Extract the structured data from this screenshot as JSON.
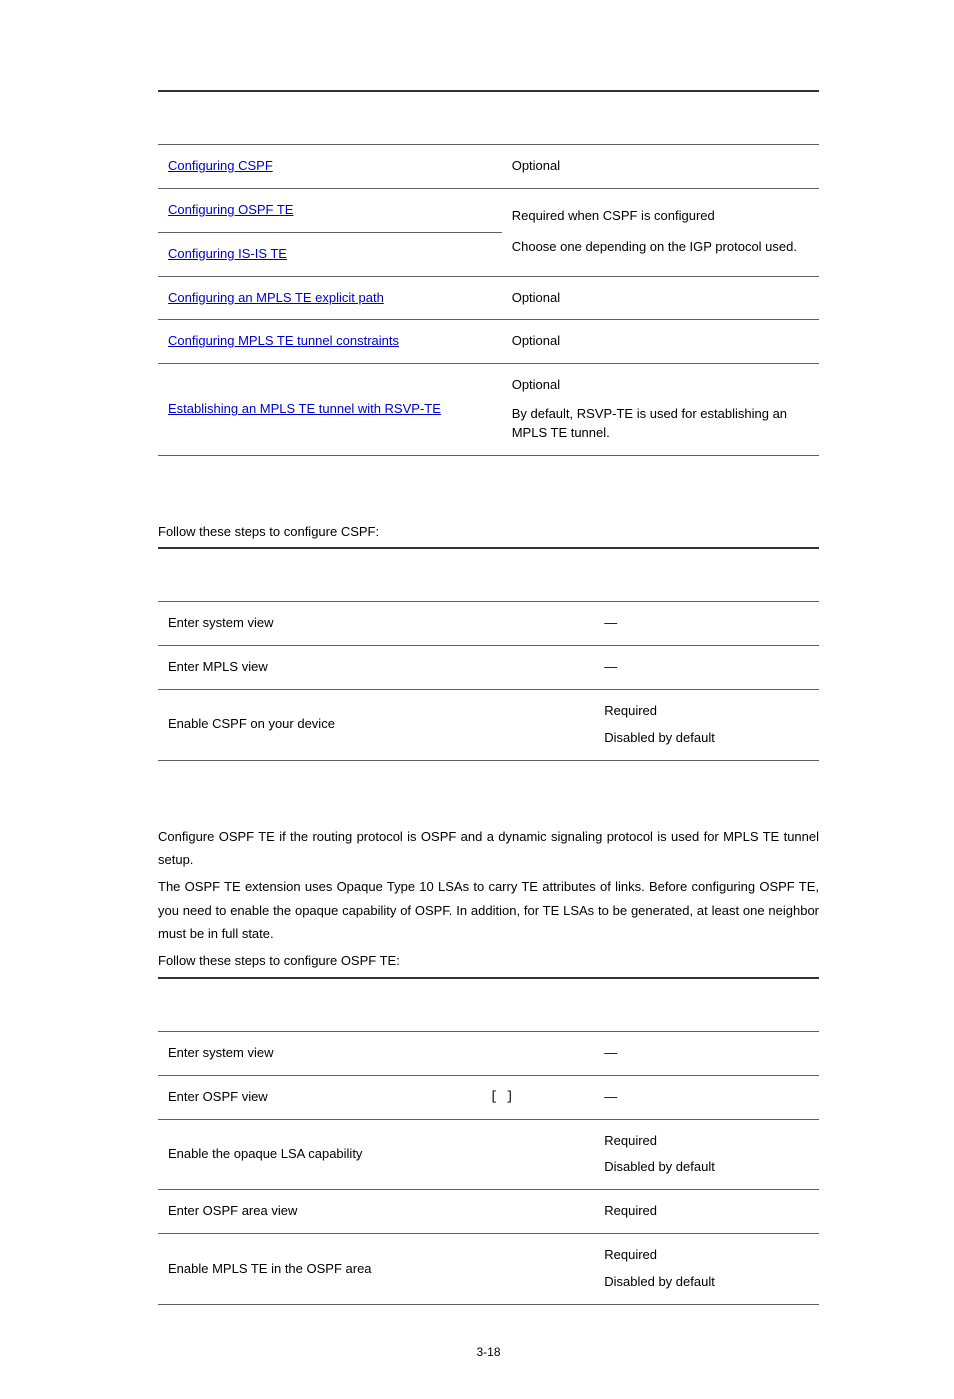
{
  "table1": {
    "cspf_link": "Configuring CSPF",
    "cspf_desc": "Optional",
    "ospf_te_link": "Configuring OSPF TE",
    "isis_te_link": "Configuring IS-IS TE",
    "te_desc_line1": "Required when CSPF is configured",
    "te_desc_line2": "Choose one depending on the IGP protocol used.",
    "explicit_path_link": "Configuring an MPLS TE explicit path",
    "explicit_path_desc": "Optional",
    "tunnel_constraints_link": "Configuring MPLS TE tunnel constraints",
    "tunnel_constraints_desc": "Optional",
    "rsvp_link": "Establishing an MPLS TE tunnel with RSVP-TE",
    "rsvp_desc_line1": "Optional",
    "rsvp_desc_line2": "By default, RSVP-TE is used for establishing an MPLS TE tunnel."
  },
  "cspf": {
    "intro": "Follow these steps to configure CSPF:",
    "r1_desc": "Enter system view",
    "r1_rem": "—",
    "r2_desc": "Enter MPLS view",
    "r2_rem": "—",
    "r3_desc": "Enable CSPF on your device",
    "r3_rem_l1": "Required",
    "r3_rem_l2": "Disabled by default"
  },
  "ospf_te": {
    "p1": "Configure OSPF TE if the routing protocol is OSPF and a dynamic signaling protocol is used for MPLS TE tunnel setup.",
    "p2": "The OSPF TE extension uses Opaque Type 10 LSAs to carry TE attributes of links. Before configuring OSPF TE, you need to enable the opaque capability of OSPF. In addition, for TE LSAs to be generated, at least one neighbor must be in full state.",
    "intro": "Follow these steps to configure OSPF TE:",
    "r1_desc": "Enter system view",
    "r1_rem": "—",
    "r2_desc": "Enter OSPF view",
    "r2_cmd": "[          ]",
    "r2_rem": "—",
    "r3_desc": "Enable the opaque LSA capability",
    "r3_rem_l1": "Required",
    "r3_rem_l2": "Disabled by default",
    "r4_desc": "Enter OSPF area view",
    "r4_rem": "Required",
    "r5_desc": "Enable MPLS TE in the OSPF area",
    "r5_rem_l1": "Required",
    "r5_rem_l2": "Disabled by default"
  },
  "page_number": "3-18"
}
